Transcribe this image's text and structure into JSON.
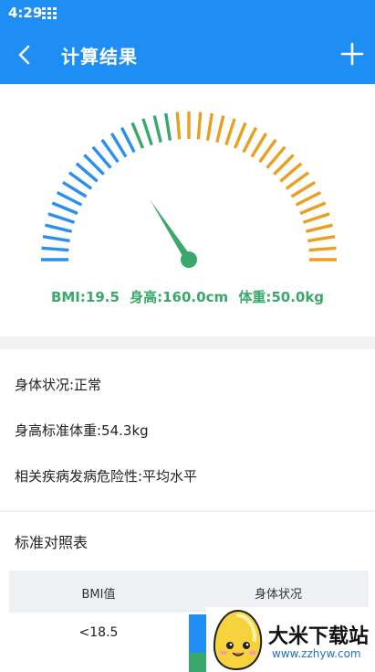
{
  "status_bar": {
    "time": "4:29"
  },
  "app_bar": {
    "title": "计算结果",
    "back_icon": "back-arrow-icon",
    "add_icon": "plus-icon"
  },
  "gauge": {
    "bmi_text": "BMI:19.5",
    "height_text": "身高:160.0cm",
    "weight_text": "体重:50.0kg",
    "bmi_value": 19.5,
    "colors": {
      "blue": "#2b8ff0",
      "green": "#3aa86a",
      "orange": "#e9a020",
      "needle": "#3aa86a"
    }
  },
  "info": {
    "status": "身体状况:正常",
    "standard_weight": "身高标准体重:54.3kg",
    "disease_risk": "相关疾病发病危险性:平均水平"
  },
  "table": {
    "title": "标准对照表",
    "headers": [
      "BMI值",
      "身体状况"
    ],
    "rows": [
      {
        "bmi": "<18.5"
      }
    ]
  },
  "watermark": {
    "name": "大米下载站",
    "url": "www.zzhyw.com"
  }
}
